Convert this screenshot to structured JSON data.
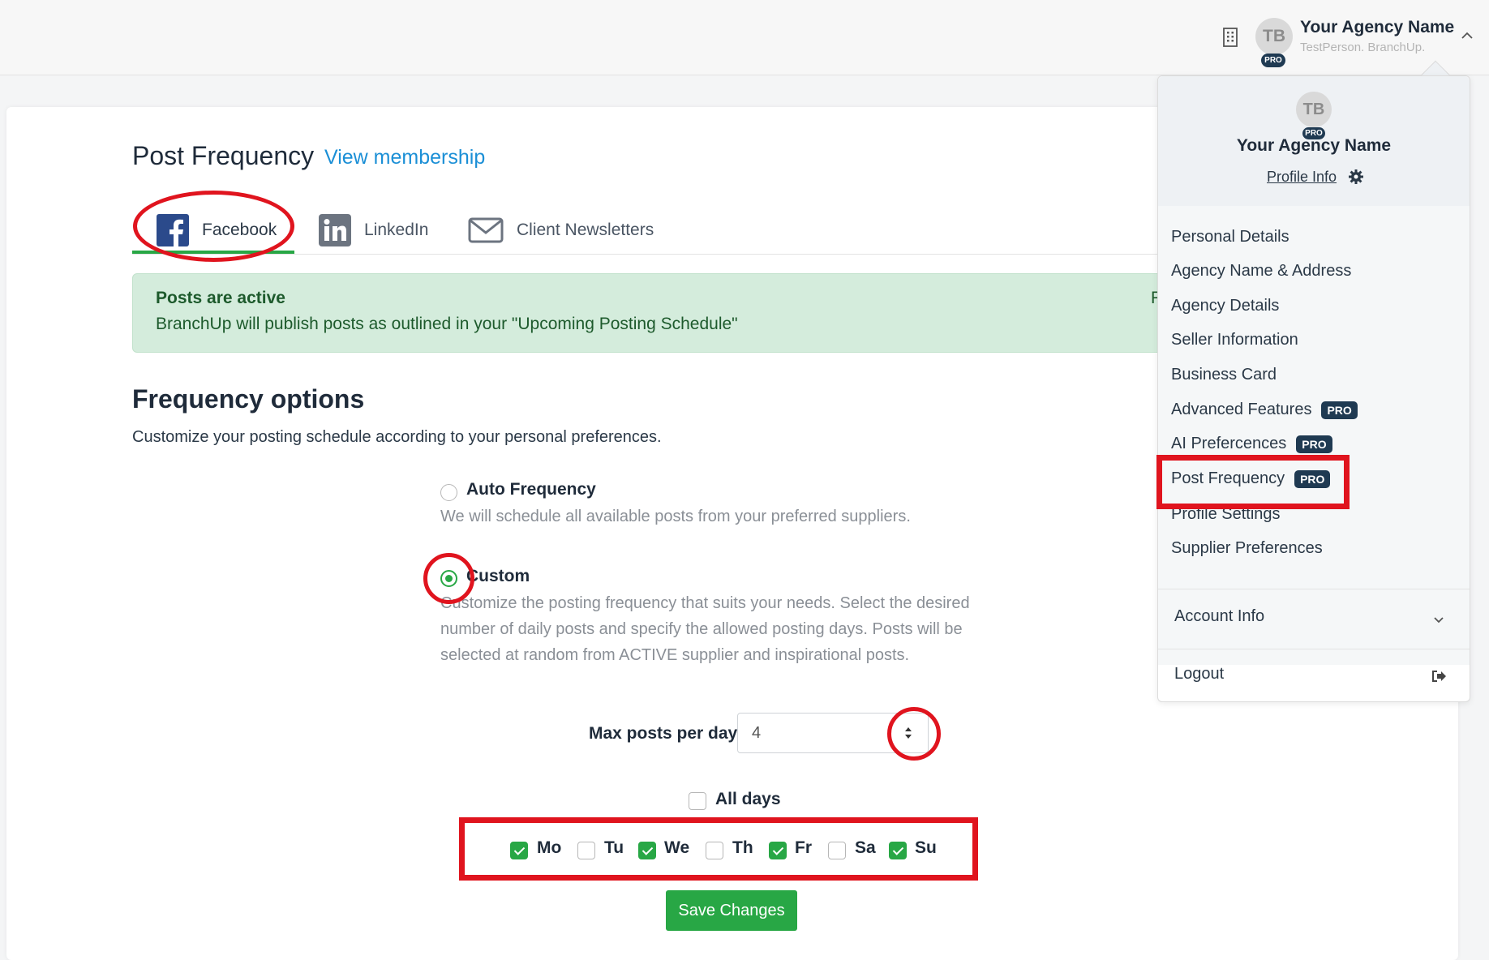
{
  "header": {
    "building_icon": "building-icon",
    "avatar_initials": "TB",
    "pro_label": "PRO",
    "agency_name": "Your Agency Name",
    "sub_text": "TestPerson. BranchUp.",
    "chevron_icon": "chevron-up-icon"
  },
  "page": {
    "title": "Post Frequency",
    "view_membership": "View membership"
  },
  "tabs": [
    {
      "label": "Facebook",
      "icon": "facebook-icon",
      "active": true
    },
    {
      "label": "LinkedIn",
      "icon": "linkedin-icon",
      "active": false
    },
    {
      "label": "Client Newsletters",
      "icon": "mail-icon",
      "active": false
    }
  ],
  "alert": {
    "title": "Posts are active",
    "text": "BranchUp will publish posts as outlined in your \"Upcoming Posting Schedule\"",
    "clipped_fragment": "F"
  },
  "frequency": {
    "title": "Frequency options",
    "subtitle": "Customize your posting schedule according to your personal preferences.",
    "options": [
      {
        "label": "Auto Frequency",
        "description": "We will schedule all available posts from your preferred suppliers.",
        "checked": false
      },
      {
        "label": "Custom",
        "description": "Customize the posting frequency that suits your needs. Select the desired number of daily posts and specify the allowed posting days. Posts will be selected at random from ACTIVE supplier and inspirational posts.",
        "checked": true
      }
    ],
    "max_posts_label": "Max posts per day",
    "max_posts_value": "4",
    "all_days_label": "All days",
    "all_days_checked": false,
    "days": [
      {
        "label": "Mo",
        "checked": true
      },
      {
        "label": "Tu",
        "checked": false
      },
      {
        "label": "We",
        "checked": true
      },
      {
        "label": "Th",
        "checked": false
      },
      {
        "label": "Fr",
        "checked": true
      },
      {
        "label": "Sa",
        "checked": false
      },
      {
        "label": "Su",
        "checked": true
      }
    ],
    "save_label": "Save Changes"
  },
  "dropdown": {
    "avatar_initials": "TB",
    "pro_label": "PRO",
    "name": "Your Agency Name",
    "profile_info": "Profile Info",
    "items": [
      {
        "label": "Personal Details",
        "pro": false
      },
      {
        "label": "Agency Name & Address",
        "pro": false
      },
      {
        "label": "Agency Details",
        "pro": false
      },
      {
        "label": "Seller Information",
        "pro": false
      },
      {
        "label": "Business Card",
        "pro": false
      },
      {
        "label": "Advanced Features",
        "pro": true
      },
      {
        "label": "AI Prefercences",
        "pro": true
      },
      {
        "label": "Post Frequency",
        "pro": true
      },
      {
        "label": "Profile Settings",
        "pro": false
      },
      {
        "label": "Supplier Preferences",
        "pro": false
      }
    ],
    "account_info": "Account Info",
    "logout": "Logout"
  },
  "colors": {
    "accent_green": "#28a745",
    "link_blue": "#1b8fd6",
    "annotation_red": "#e0141e",
    "pro_badge": "#1f3a52"
  }
}
